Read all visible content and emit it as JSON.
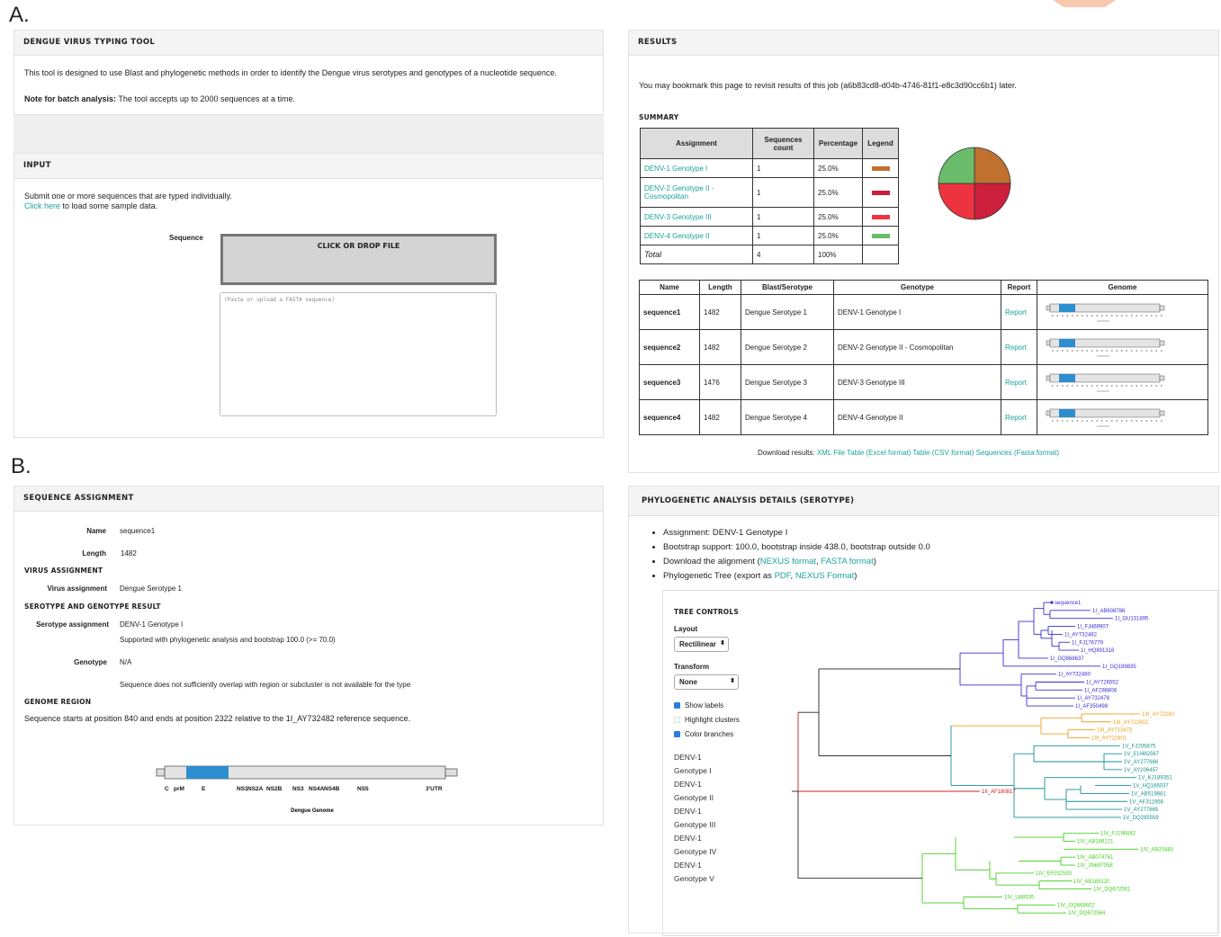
{
  "panel_labels": {
    "a": "A.",
    "b": "B."
  },
  "tool": {
    "title": "DENGUE VIRUS TYPING TOOL",
    "description": "This tool is designed to use Blast and phylogenetic methods in order to identify the Dengue virus serotypes and genotypes of a nucleotide sequence.",
    "note_label": "Note for batch analysis:",
    "note_text": "The tool accepts up to 2000 sequences at a time."
  },
  "input": {
    "title": "INPUT",
    "instructions": "Submit one or more sequences that are typed individually.",
    "sample_link": "Click here",
    "sample_text": "to load some sample data.",
    "sequence_label": "Sequence",
    "drop_label": "CLICK OR DROP FILE",
    "textarea_placeholder": "(Paste or upload a FASTA sequence)"
  },
  "results": {
    "title": "RESULTS",
    "bookmark": "You may bookmark this page to revisit results of this job (a6b83cd8-d04b-4746-81f1-e8c3d90cc6b1) later.",
    "summary_title": "SUMMARY",
    "summary_headers": [
      "Assignment",
      "Sequences count",
      "Percentage",
      "Legend"
    ],
    "summary_rows": [
      {
        "assignment": "DENV-1 Genotype I",
        "count": "1",
        "pct": "25.0%",
        "color": "#c0702f"
      },
      {
        "assignment": "DENV-2 Genotype II - Cosmopolitan",
        "count": "1",
        "pct": "25.0%",
        "color": "#cc1f3c"
      },
      {
        "assignment": "DENV-3 Genotype III",
        "count": "1",
        "pct": "25.0%",
        "color": "#ee3340"
      },
      {
        "assignment": "DENV-4 Genotype II",
        "count": "1",
        "pct": "25.0%",
        "color": "#6abc6a"
      }
    ],
    "summary_total": {
      "label": "Total",
      "count": "4",
      "pct": "100%"
    },
    "result_headers": [
      "Name",
      "Length",
      "Blast/Serotype",
      "Genotype",
      "Report",
      "Genome"
    ],
    "result_rows": [
      {
        "name": "sequence1",
        "length": "1482",
        "serotype": "Dengue Serotype 1",
        "genotype": "DENV-1 Genotype I",
        "report": "Report"
      },
      {
        "name": "sequence2",
        "length": "1482",
        "serotype": "Dengue Serotype 2",
        "genotype": "DENV-2 Genotype II - Cosmopolitan",
        "report": "Report"
      },
      {
        "name": "sequence3",
        "length": "1476",
        "serotype": "Dengue Serotype 3",
        "genotype": "DENV-3 Genotype III",
        "report": "Report"
      },
      {
        "name": "sequence4",
        "length": "1482",
        "serotype": "Dengue Serotype 4",
        "genotype": "DENV-4 Genotype II",
        "report": "Report"
      }
    ],
    "download_label": "Download results:",
    "download_links": [
      "XML File",
      "Table (Excel format)",
      "Table (CSV format)",
      "Sequences (Fasta format)"
    ]
  },
  "assignment": {
    "title": "SEQUENCE ASSIGNMENT",
    "name_label": "Name",
    "name_value": "sequence1",
    "length_label": "Length",
    "length_value": "1482",
    "virus_section": "VIRUS ASSIGNMENT",
    "virus_label": "Virus assignment",
    "virus_value": "Dengue Serotype 1",
    "sg_section": "SEROTYPE AND GENOTYPE RESULT",
    "serotype_label": "Serotype assignment",
    "serotype_value": "DENV-1 Genotype I",
    "support_text": "Supported with phylogenetic analysis and bootstrap 100.0 (>= 70.0)",
    "genotype_label": "Genotype",
    "genotype_value": "N/A",
    "overlap_text": "Sequence does not sufficiently overlap with region or subcluster is not available for the type",
    "genome_section": "GENOME REGION",
    "genome_text": "Sequence starts at position 840 and ends at position 2322 relative to the 1I_AY732482 reference sequence.",
    "genome_map_labels": [
      "C",
      "prM",
      "E",
      "NS1",
      "NS2A",
      "NS2B",
      "NS3",
      "NS4A",
      "NS4B",
      "NS5",
      "3'UTR"
    ],
    "genome_caption": "Dengue Genome"
  },
  "phylo": {
    "title": "PHYLOGENETIC ANALYSIS DETAILS (SEROTYPE)",
    "assignment": "Assignment: DENV-1 Genotype I",
    "bootstrap": "Bootstrap support: 100.0, bootstrap inside 438.0, bootstrap outside 0.0",
    "download_prefix": "Download the alignment (",
    "nexus": "NEXUS format",
    "fasta": "FASTA format",
    "tree_prefix": "Phylogenetic Tree (export as ",
    "pdf": "PDF",
    "nexus2": "NEXUS Format",
    "controls_title": "TREE CONTROLS",
    "layout_label": "Layout",
    "layout_value": "Rectilinear",
    "transform_label": "Transform",
    "transform_value": "None",
    "show_labels": "Show labels",
    "highlight": "Highlight clusters",
    "color_branches": "Color branches",
    "legend": [
      {
        "line1": "DENV-1",
        "line2": "Genotype I",
        "color": "#3a2fd0"
      },
      {
        "line1": "DENV-1",
        "line2": "Genotype II",
        "color": "#e8a020"
      },
      {
        "line1": "DENV-1",
        "line2": "Genotype III",
        "color": "#d02020"
      },
      {
        "line1": "DENV-1",
        "line2": "Genotype IV",
        "color": "#1a9090"
      },
      {
        "line1": "DENV-1",
        "line2": "Genotype V",
        "color": "#44d020"
      }
    ],
    "leaves": [
      "sequence1",
      "1I_AB608786",
      "1I_GU131895",
      "1I_FJ469907",
      "1I_AY732482",
      "1I_FJ176779",
      "1I_HQ891316",
      "1I_GQ868637",
      "1I_GQ199835",
      "1I_AY732480",
      "1I_AY726552",
      "1I_AF298808",
      "1I_AY732478",
      "1I_AF350498",
      "1III_AY72280",
      "1III_AY722802",
      "1III_AY713473",
      "1III_AY722801",
      "1V_FJ205875",
      "1V_EU482567",
      "1V_AY277666",
      "1V_AY206457",
      "1V_KJ189351",
      "1V_HQ166037",
      "1V_AB519681",
      "1V_AF311956",
      "1V_AY277665",
      "1V_DQ285559",
      "1II_AF180817",
      "1IV_FJ196842",
      "1IV_AB189121",
      "1IV_AB20480",
      "1IV_AB074761",
      "1IV_JN697058",
      "1IV_EF032590",
      "1IV_AB189120",
      "1IV_DQ672561",
      "1IV_U88535",
      "1IV_GQ868602",
      "1IV_DQ672564"
    ]
  }
}
